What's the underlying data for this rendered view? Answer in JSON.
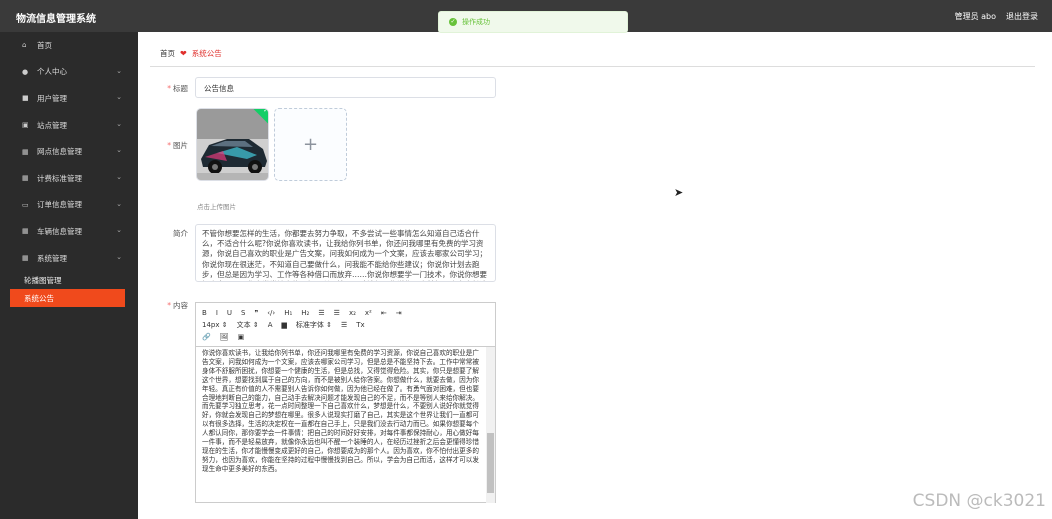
{
  "header": {
    "app_title": "物流信息管理系统",
    "user_label": "管理员 abo",
    "logout_label": "退出登录"
  },
  "toast": {
    "icon": "check-circle-icon",
    "message": "操作成功"
  },
  "sidebar": {
    "items": [
      {
        "icon": "home-icon",
        "label": "首页",
        "has_arrow": false
      },
      {
        "icon": "user-icon",
        "label": "个人中心",
        "has_arrow": true
      },
      {
        "icon": "users-icon",
        "label": "用户管理",
        "has_arrow": true
      },
      {
        "icon": "site-icon",
        "label": "站点管理",
        "has_arrow": true
      },
      {
        "icon": "grid-icon",
        "label": "网点信息管理",
        "has_arrow": true
      },
      {
        "icon": "grid-icon",
        "label": "计费标准管理",
        "has_arrow": true
      },
      {
        "icon": "monitor-icon",
        "label": "订单信息管理",
        "has_arrow": true
      },
      {
        "icon": "grid-icon",
        "label": "车辆信息管理",
        "has_arrow": true
      },
      {
        "icon": "grid-icon",
        "label": "系统管理",
        "has_arrow": true
      }
    ],
    "subitems": [
      {
        "label": "轮播图管理",
        "active": false
      },
      {
        "label": "系统公告",
        "active": true
      }
    ]
  },
  "breadcrumb": {
    "home": "首页",
    "current": "系统公告"
  },
  "form": {
    "title_label": "标题",
    "title_value": "公告信息",
    "image_label": "图片",
    "upload_hint": "点击上传图片",
    "intro_label": "简介",
    "intro_text": "不管你想要怎样的生活，你都要去努力争取，不多尝试一些事情怎么知道自己适合什么，不适合什么呢?你说你喜欢读书，让我给你列书单，你还问我哪里有免费的学习资源，你说自己喜欢的职业是广告文案，问我如何成为一个文案，应该去哪家公司学习；你说你现在很迷茫，不知道自己要做什么，问我能不能给你些建议……你想要的为什么总是别人给你答案？你该好好问问你自己。",
    "intro_text_visible": "不管你想要怎样的生活，你都要去努力争取，不多尝试一些事情怎么知道自己适合什么，不适合什么呢?你说你喜欢读书，让我给你列书单，你还问我哪里有免费的学习资源，你说自己喜欢的职业是广告文案，问我如何成为一个文案，应该去哪家公司学习；你说你现在很迷茫，不知道自己要做什么，问我能不能给你些建议；你说你计划去跑步，但总是因为学习、工作等各种借口而放弃……你说你想要学一门技术，你说你想要提高自己。工作中常常被身体不舒服所困扰而不敢请假；你说你一直梦想一个人去长途旅行，但是总找，又得觉得危险。测试",
    "content_label": "内容",
    "toolbar_row1": [
      "B",
      "I",
      "U",
      "S",
      "❞",
      "‹/›",
      "H₁",
      "H₂",
      "☰",
      "☰",
      "x₂",
      "x²",
      "⇤",
      "⇥"
    ],
    "toolbar_row2": {
      "size": "14px",
      "para": "文本",
      "color": "A",
      "bg": "▆",
      "font": "标准字体",
      "align": "☰",
      "clear": "Tx"
    },
    "toolbar_row3": [
      "🔗",
      "🖼",
      "▣"
    ],
    "content_text": "你说你喜欢读书，让我给你列书单，你还问我哪里有免费的学习资源，你说自己喜欢的职业是广告文案，问我如何成为一个文案，应该去哪家公司学习，但是总是不能坚持下去。工作中常常被身体不舒服所困扰，你想要一个健康的生活，但是总找，又得觉得危险。其实，你只是想要了解这个世界，想要找到属于自己的方向，而不是被别人给你答案。你想做什么，就要去做，因为你年轻。真正有价值的人不需要别人告诉你如何做，因为他已经在做了。有勇气面对困难，但也要合理地判断自己的能力，自己动手去解决问题才能发现自己的不足，而不是等别人来给你解决。而先要学习独立思考，花一点时间整理一下自己喜欢什么，梦想是什么，不要别人说好你就觉得好，你就会发现自己的梦想在哪里。很多人说现实打磨了自己，其实是这个世界让我们一直都可以有很多选择，生活的决定权在一直都在自己手上，只是我们没去行动力而已。如果你想要每个人都认同你，那你要学会一件事情：把自己的时间好好安排，对每件事都保持耐心，用心做好每一件事，而不是轻易放弃，就像你永远也叫不醒一个装睡的人，在经历过挫折之后会更懂得珍惜现在的生活，你才能慢慢变成更好的自己，你想要成为的那个人。因为喜欢，你不怕付出更多的努力，也因为喜欢，你能在坚持的过程中慢慢找到自己。所以，学会为自己而活，这样才可以发现生命中更多美好的东西。"
  },
  "watermark": "CSDN @ck3021"
}
